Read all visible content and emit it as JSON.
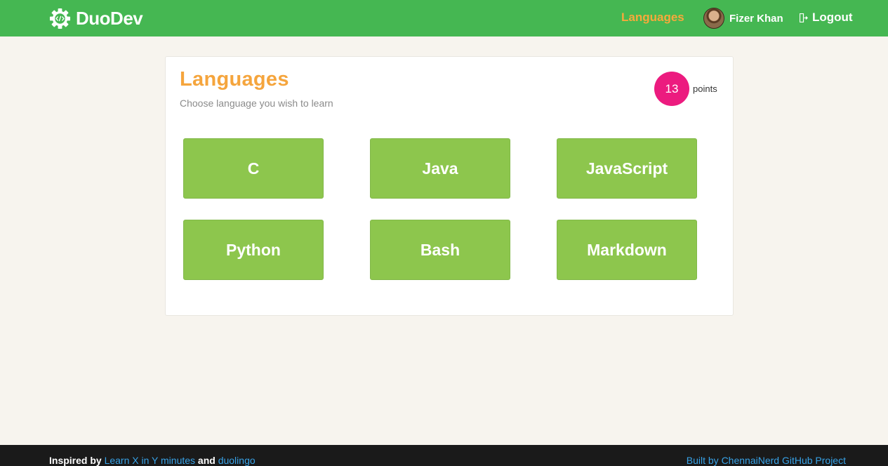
{
  "header": {
    "brand": "DuoDev",
    "nav_languages": "Languages",
    "user_name": "Fizer Khan",
    "logout": "Logout"
  },
  "card": {
    "title": "Languages",
    "subtitle": "Choose language you wish to learn",
    "points_value": "13",
    "points_label": "points",
    "languages": [
      "C",
      "Java",
      "JavaScript",
      "Python",
      "Bash",
      "Markdown"
    ]
  },
  "footer": {
    "inspired_by": "Inspired by",
    "link1": "Learn X in Y minutes",
    "and": "and",
    "link2": "duolingo",
    "built_by": "Built by ChennaiNerd",
    "github": "GitHub Project"
  },
  "colors": {
    "header_bg": "#45b752",
    "accent_orange": "#f5a53d",
    "button_green": "#8dc64d",
    "points_pink": "#ec1b7f",
    "link_blue": "#38a3e8"
  },
  "icons": {
    "brand": "gear-code-icon",
    "logout": "logout-icon"
  }
}
